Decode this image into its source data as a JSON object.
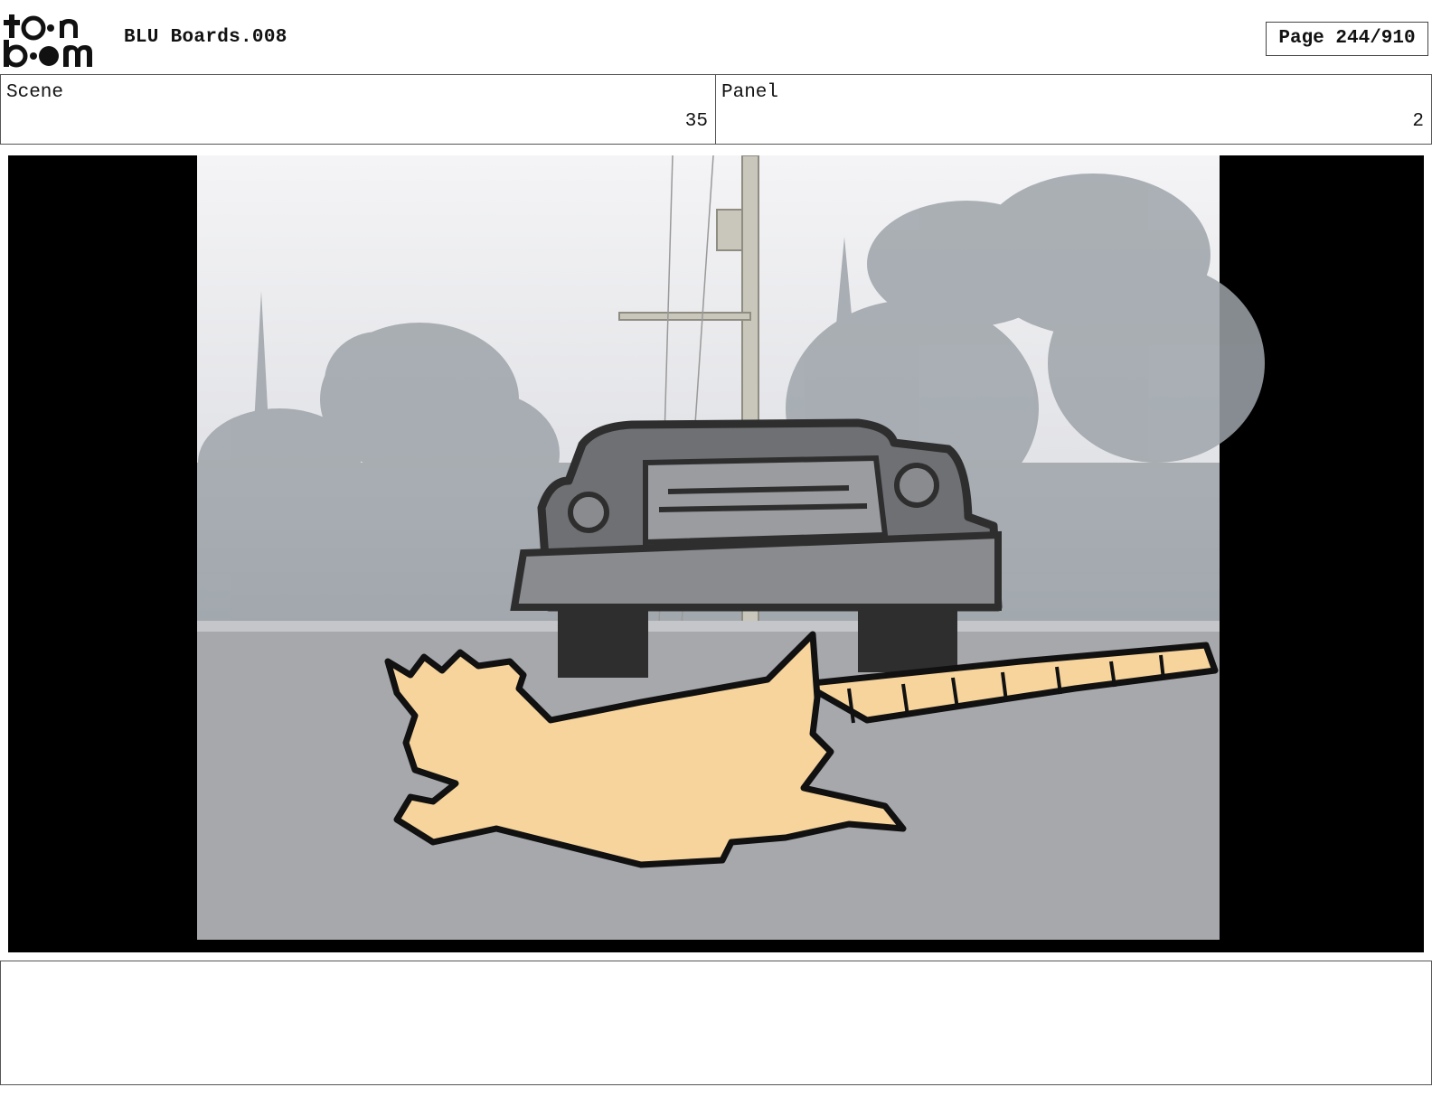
{
  "header": {
    "logo_text_top": "toon",
    "logo_text_bottom": "boom",
    "document_title": "BLU Boards.008",
    "page_indicator": "Page 244/910"
  },
  "info": {
    "scene_label": "Scene",
    "scene_value": "35",
    "panel_label": "Panel",
    "panel_value": "2"
  },
  "panel_image": {
    "description_icon": "storyboard-frame",
    "letterbox_color": "#000000",
    "rat_color": "#f6d49c",
    "car_color": "#2e2e2e",
    "haze_color": "#b4b8bd"
  },
  "notes": {
    "text": ""
  }
}
